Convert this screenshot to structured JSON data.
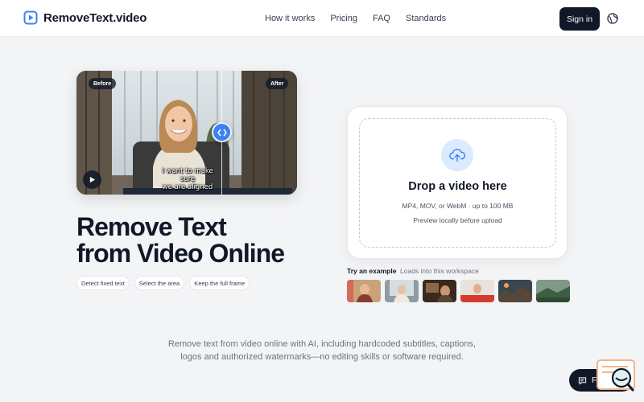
{
  "header": {
    "brand": "RemoveText.video",
    "nav": [
      {
        "label": "How it works"
      },
      {
        "label": "Pricing"
      },
      {
        "label": "FAQ"
      },
      {
        "label": "Standards"
      }
    ],
    "signin_label": "Sign in",
    "language_icon": "globe-icon"
  },
  "preview": {
    "before_label": "Before",
    "after_label": "After",
    "subtitle_line1": "I want to make sure",
    "subtitle_line2": "we are aligned",
    "play_icon": "play-icon",
    "handle_icon": "compare-handle-icon"
  },
  "hero": {
    "title_line1": "Remove Text",
    "title_line2": "from Video Online",
    "chips": [
      "Detect fixed text",
      "Select the area",
      "Keep the full frame"
    ]
  },
  "upload": {
    "title": "Drop a video here",
    "formats": "MP4, MOV, or WebM · up to 100 MB",
    "note": "Preview locally before upload",
    "icon": "cloud-upload-icon"
  },
  "examples": {
    "label": "Try an example",
    "sublabel": "Loads into this workspace",
    "count": 6
  },
  "description": {
    "line1": "Remove text from video online with AI, including hardcoded subtitles, captions,",
    "line2": "logos and authorized watermarks—no editing skills or software required."
  },
  "feedback": {
    "label": "Feedb"
  },
  "colors": {
    "accent": "#3b82f6",
    "dark": "#111827",
    "background": "#f3f4f6"
  }
}
